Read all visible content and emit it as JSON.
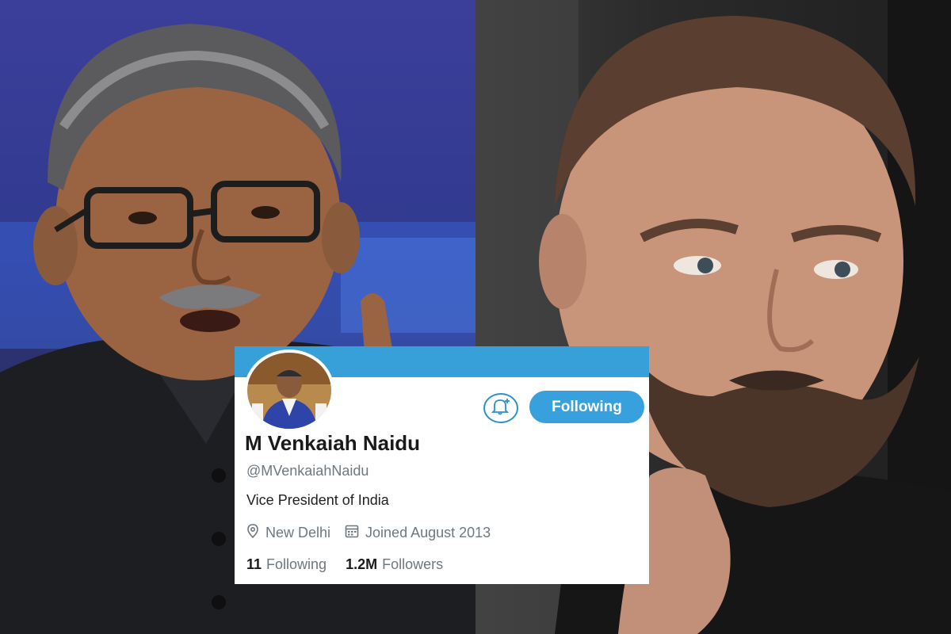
{
  "profile": {
    "display_name": "M Venkaiah Naidu",
    "handle": "@MVenkaiahNaidu",
    "bio": "Vice President of India",
    "location": "New Delhi",
    "joined": "Joined August 2013",
    "following_count": "11",
    "following_label": "Following",
    "followers_count": "1.2M",
    "followers_label": "Followers",
    "follow_button_label": "Following"
  },
  "colors": {
    "banner": "#38a0d8",
    "accent": "#38a0dc"
  },
  "icons": {
    "bell": "bell-plus-icon",
    "location": "location-pin-icon",
    "calendar": "calendar-icon"
  }
}
